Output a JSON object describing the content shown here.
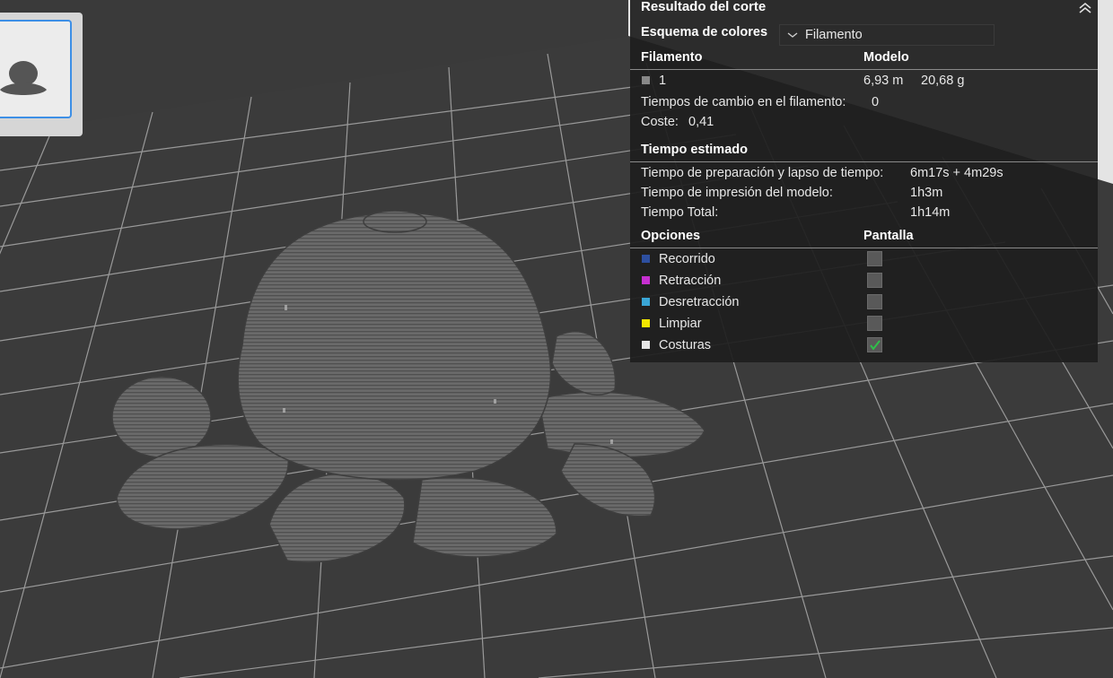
{
  "panel": {
    "title": "Resultado del corte",
    "collapse_icon": "double-chevron-up-icon",
    "color_scheme_label": "Esquema de colores",
    "color_scheme_value": "Filamento",
    "filament_header": "Filamento",
    "model_header": "Modelo",
    "filament": {
      "number": "1",
      "length": "6,93 m",
      "weight": "20,68 g",
      "swatch_color": "#888888"
    },
    "filament_changes_label": "Tiempos de cambio en el filamento:",
    "filament_changes_value": "0",
    "cost_label": "Coste:",
    "cost_value": "0,41",
    "estimated_time_header": "Tiempo estimado",
    "prep_time_label": "Tiempo de preparación y lapso de tiempo:",
    "prep_time_value": "6m17s + 4m29s",
    "model_print_time_label": "Tiempo de impresión del modelo:",
    "model_print_time_value": "1h3m",
    "total_time_label": "Tiempo Total:",
    "total_time_value": "1h14m",
    "options_header": "Opciones",
    "display_header": "Pantalla",
    "options": [
      {
        "label": "Recorrido",
        "color": "#2d4fa0",
        "checked": false
      },
      {
        "label": "Retracción",
        "color": "#c62fd0",
        "checked": false
      },
      {
        "label": "Desretracción",
        "color": "#3aa6d6",
        "checked": false
      },
      {
        "label": "Limpiar",
        "color": "#f2e600",
        "checked": false
      },
      {
        "label": "Costuras",
        "color": "#e6e6e6",
        "checked": true
      }
    ]
  }
}
